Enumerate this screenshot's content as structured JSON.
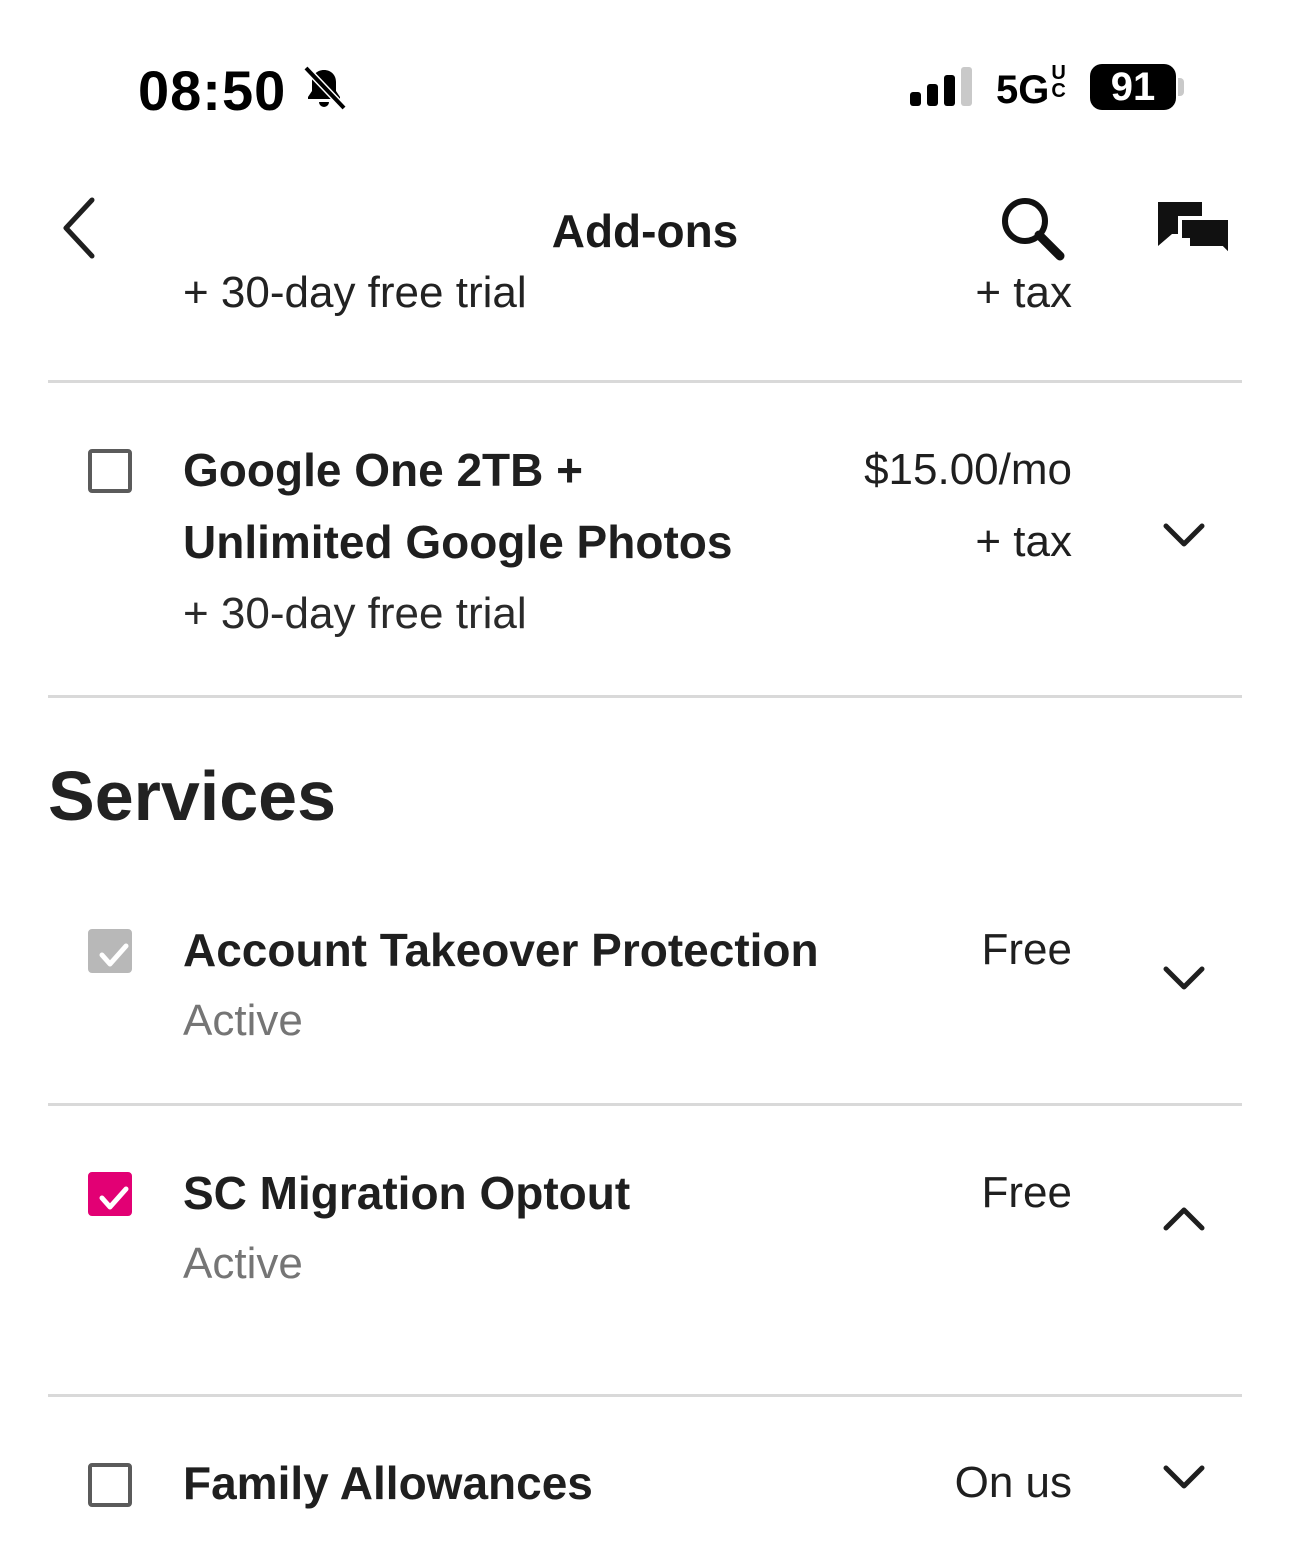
{
  "status_bar": {
    "time": "08:50",
    "network": "5G",
    "network_suffix": "UC",
    "battery": "91"
  },
  "header": {
    "title": "Add-ons"
  },
  "partial_item": {
    "subtitle": "+ 30-day free trial",
    "price_suffix": "+ tax"
  },
  "addons": [
    {
      "name_line1": "Google One 2TB +",
      "name_line2": "Unlimited Google Photos",
      "subtitle": "+ 30-day free trial",
      "price": "$15.00/mo",
      "price_suffix": "+ tax",
      "checked": false
    }
  ],
  "services": {
    "title": "Services",
    "items": [
      {
        "name": "Account Takeover Protection",
        "status": "Active",
        "price": "Free",
        "checked": true,
        "locked": true,
        "expanded": false
      },
      {
        "name": "SC Migration Optout",
        "status": "Active",
        "price": "Free",
        "checked": true,
        "locked": false,
        "expanded": true
      },
      {
        "name": "Family Allowances",
        "price": "On us",
        "checked": false,
        "expanded": false
      }
    ]
  },
  "colors": {
    "accent": "#e20074",
    "disabled_check": "#b8b8b8",
    "divider": "#d9d9d9",
    "muted_text": "#757575"
  }
}
